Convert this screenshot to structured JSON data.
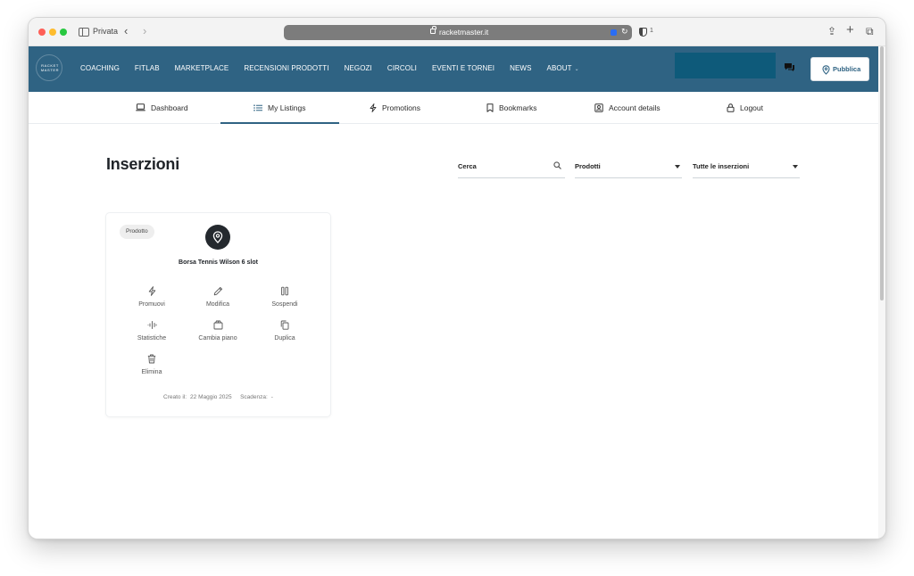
{
  "browser": {
    "private_label": "Privata",
    "url": "racketmaster.it",
    "extension_count": "1"
  },
  "site": {
    "logo_text": "RACKET MASTER",
    "nav": [
      {
        "label": "COACHING"
      },
      {
        "label": "FITLAB"
      },
      {
        "label": "MARKETPLACE"
      },
      {
        "label": "RECENSIONI PRODOTTI"
      },
      {
        "label": "NEGOZI"
      },
      {
        "label": "CIRCOLI"
      },
      {
        "label": "EVENTI E TORNEI"
      },
      {
        "label": "NEWS"
      },
      {
        "label": "ABOUT"
      }
    ],
    "publish_label": "Pubblica"
  },
  "account_tabs": [
    {
      "label": "Dashboard",
      "icon": "laptop-icon"
    },
    {
      "label": "My Listings",
      "icon": "list-icon"
    },
    {
      "label": "Promotions",
      "icon": "bolt-icon"
    },
    {
      "label": "Bookmarks",
      "icon": "bookmark-icon"
    },
    {
      "label": "Account details",
      "icon": "user-box-icon"
    },
    {
      "label": "Logout",
      "icon": "lock-icon"
    }
  ],
  "page": {
    "title": "Inserzioni",
    "search_placeholder": "Cerca",
    "category_filter": "Prodotti",
    "status_filter": "Tutte le inserzioni"
  },
  "listing": {
    "badge": "Prodotto",
    "title": "Borsa Tennis Wilson 6 slot",
    "actions": [
      {
        "label": "Promuovi",
        "icon": "bolt-icon"
      },
      {
        "label": "Modifica",
        "icon": "pencil-icon"
      },
      {
        "label": "Sospendi",
        "icon": "pause-icon"
      },
      {
        "label": "Statistiche",
        "icon": "stats-icon"
      },
      {
        "label": "Cambia piano",
        "icon": "package-icon"
      },
      {
        "label": "Duplica",
        "icon": "copy-icon"
      },
      {
        "label": "Elimina",
        "icon": "trash-icon"
      }
    ],
    "created_label": "Creato il:",
    "created_value": "22 Maggio 2025",
    "expiry_label": "Scadenza:",
    "expiry_value": "-"
  },
  "colors": {
    "header_bg": "#2f6383",
    "accent": "#2f6383",
    "header_box": "#0e5a7a"
  }
}
